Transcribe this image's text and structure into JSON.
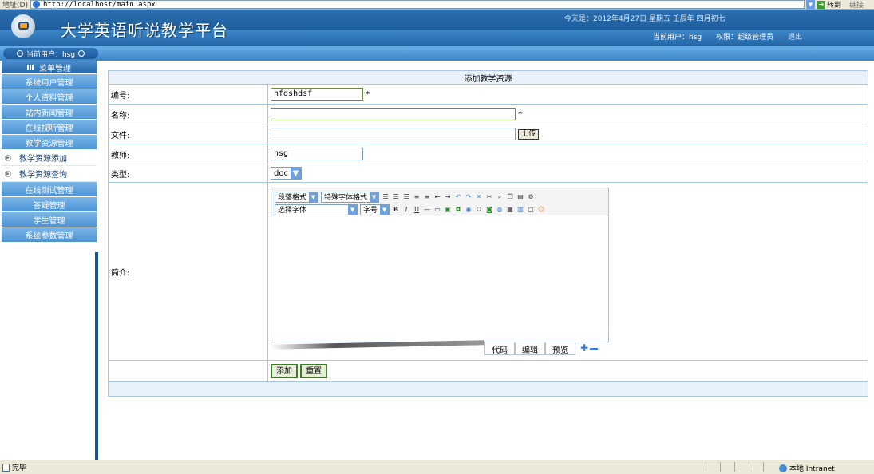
{
  "browser": {
    "address_label": "地址(D)",
    "url": "http://localhost/main.aspx",
    "go_label": "转到",
    "links_label": "链接",
    "status_text": "完毕",
    "zone_text": "本地 Intranet"
  },
  "header": {
    "site_title": "大学英语听说教学平台",
    "date_text": "今天是：2012年4月27日 星期五 壬辰年 四月初七",
    "current_user_text": "当前用户：hsg",
    "permission_text": "权限：超级管理员",
    "logout_label": "退出"
  },
  "sidebar": {
    "current_user": "当前用户：hsg",
    "menu_head": "菜单管理",
    "items": [
      {
        "label": "系统用户管理",
        "type": "group"
      },
      {
        "label": "个人资料管理",
        "type": "group"
      },
      {
        "label": "站内新闻管理",
        "type": "group"
      },
      {
        "label": "在线视听管理",
        "type": "group"
      },
      {
        "label": "教学资源管理",
        "type": "group"
      },
      {
        "label": "教学资源添加",
        "type": "sub"
      },
      {
        "label": "教学资源查询",
        "type": "sub"
      },
      {
        "label": "在线测试管理",
        "type": "group"
      },
      {
        "label": "答疑管理",
        "type": "group"
      },
      {
        "label": "学生管理",
        "type": "group"
      },
      {
        "label": "系统参数管理",
        "type": "group"
      }
    ]
  },
  "form": {
    "title": "添加教学资源",
    "fields": {
      "code": {
        "label": "编号:",
        "value": "hfdshdsf",
        "required_mark": "*"
      },
      "name": {
        "label": "名称:",
        "value": "",
        "required_mark": "*"
      },
      "file": {
        "label": "文件:",
        "value": "",
        "upload_label": "上传"
      },
      "teacher": {
        "label": "教师:",
        "value": "hsg"
      },
      "type": {
        "label": "类型:",
        "selected": "doc"
      },
      "intro": {
        "label": "简介:"
      }
    },
    "editor": {
      "paragraph_format": "段落格式",
      "special_format": "特殊字体格式",
      "font_select": "选择字体",
      "font_size": "字号",
      "mode_code": "代码",
      "mode_edit": "编辑",
      "mode_preview": "预览"
    },
    "add_label": "添加",
    "reset_label": "重置"
  }
}
